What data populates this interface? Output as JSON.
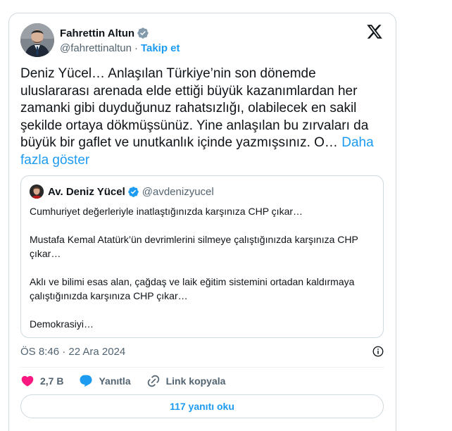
{
  "author": {
    "display_name": "Fahrettin Altun",
    "handle": "@fahrettinaltun",
    "separator": "·",
    "follow_label": "Takip et"
  },
  "tweet": {
    "text": "Deniz Yücel… Anlaşılan Türkiye’nin son dönemde uluslararası arenada elde ettiği büyük kazanımlardan her zamanki gibi duyduğunuz rahatsızlığı, olabilecek en sakil şekilde ortaya dökmüşsünüz. Yine anlaşılan bu zırvaları da büyük bir gaflet ve unutkanlık içinde yazmışsınız. O…",
    "show_more_label": "Daha fazla göster"
  },
  "quote": {
    "display_name": "Av. Deniz Yücel",
    "handle": "@avdenizyucel",
    "paragraphs": [
      "Cumhuriyet değerleriyle inatlaştığınızda karşınıza CHP çıkar…",
      "Mustafa Kemal Atatürk’ün devrimlerini silmeye çalıştığınızda karşınıza CHP çıkar…",
      "Aklı ve bilimi esas alan, çağdaş ve laik eğitim sistemini ortadan kaldırmaya çalıştığınızda karşınıza CHP çıkar…",
      "Demokrasiyi…"
    ]
  },
  "meta": {
    "timestamp": "ÖS 8:46 · 22 Ara 2024"
  },
  "actions": {
    "like_count": "2,7 B",
    "reply_label": "Yanıtla",
    "copy_link_label": "Link kopyala"
  },
  "read_replies_label": "117 yanıtı oku",
  "colors": {
    "accent": "#1d9bf0",
    "like": "#f91880",
    "secondary_text": "#536471",
    "border": "#cfd9de"
  },
  "icons": [
    "x-logo-icon",
    "verified-badge-icon",
    "info-icon",
    "heart-icon",
    "reply-bubble-icon",
    "link-icon"
  ]
}
